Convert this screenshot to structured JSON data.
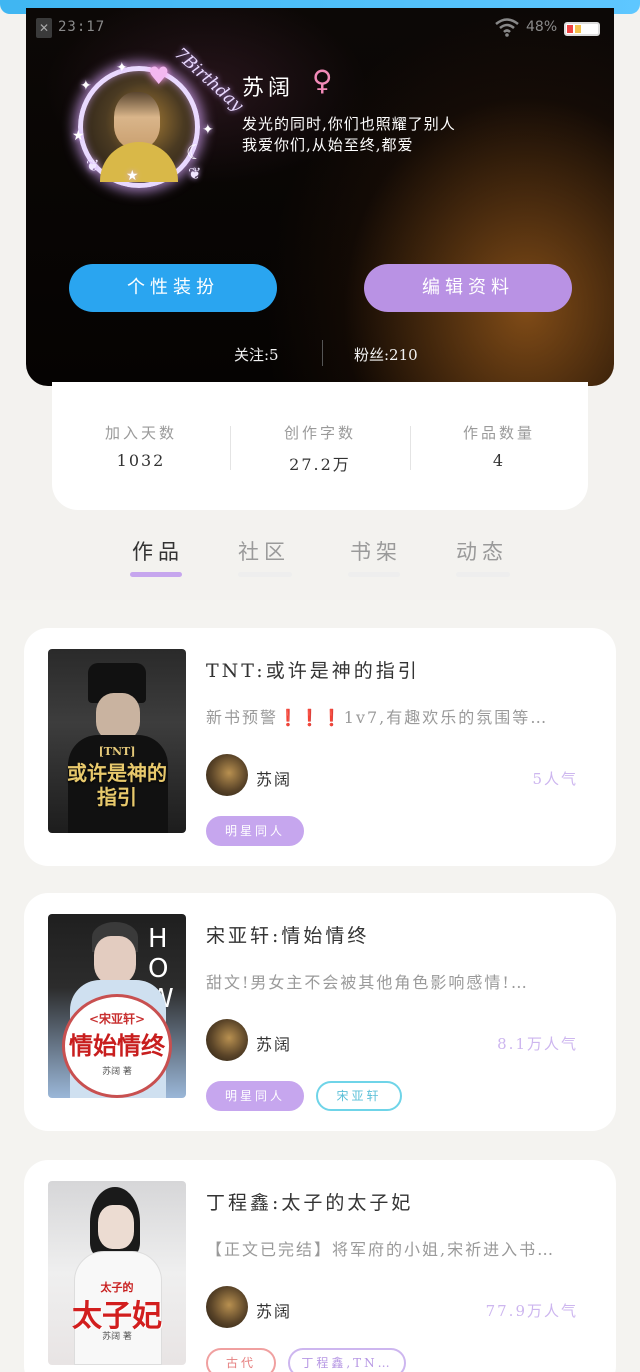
{
  "status_bar": {
    "time": "23:17",
    "battery": "48%",
    "close_glyph": "✕",
    "wifi_icon": "wifi-icon"
  },
  "profile": {
    "avatar_text": "7Birthday",
    "name": "苏阔",
    "gender_symbol": "♀",
    "bio_line1": "发光的同时,你们也照耀了别人",
    "bio_line2": "我爱你们,从始至终,都爱",
    "dress_button": "个性装扮",
    "edit_button": "编辑资料",
    "follow": "关注:5",
    "fans": "粉丝:210"
  },
  "stats": [
    {
      "label": "加入天数",
      "value": "1032"
    },
    {
      "label": "创作字数",
      "value": "27.2万"
    },
    {
      "label": "作品数量",
      "value": "4"
    }
  ],
  "tabs": [
    {
      "label": "作品",
      "active": true
    },
    {
      "label": "社区",
      "active": false
    },
    {
      "label": "书架",
      "active": false
    },
    {
      "label": "动态",
      "active": false
    }
  ],
  "works": [
    {
      "cover_title": "或许是神的指引",
      "cover_sub": "[TNT]",
      "title": "TNT:或许是神的指引",
      "desc": "新书预警❗️❗️❗️1v7,有趣欢乐的氛围等…",
      "author": "苏阔",
      "popularity": "5人气",
      "tags": [
        "明星同人"
      ]
    },
    {
      "cover_title": "情始情终",
      "cover_sub": "<宋亚轩>",
      "cover_author": "苏阔 著",
      "title": "宋亚轩:情始情终",
      "desc": "甜文!男女主不会被其他角色影响感情!…",
      "author": "苏阔",
      "popularity": "8.1万人气",
      "tags": [
        "明星同人",
        "宋亚轩"
      ]
    },
    {
      "cover_title": "太子妃",
      "cover_sub": "太子的",
      "cover_author": "苏阔 著",
      "title": "丁程鑫:太子的太子妃",
      "desc": "【正文已完结】将军府的小姐,宋祈进入书…",
      "author": "苏阔",
      "popularity": "77.9万人气",
      "tags": [
        "古代",
        "丁程鑫,TN…"
      ]
    }
  ]
}
